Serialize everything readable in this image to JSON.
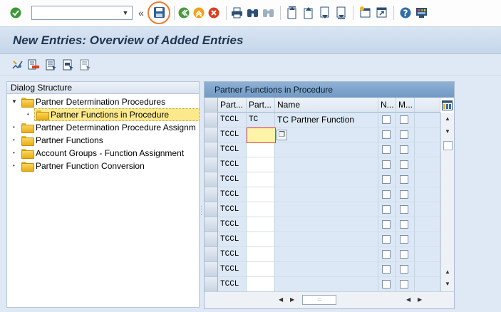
{
  "toolbar": {
    "command_field_value": "",
    "double_arrow": "«",
    "icons": [
      "enter-icon",
      "save-icon",
      "back-icon",
      "exit-icon",
      "cancel-icon",
      "print-icon",
      "find-icon",
      "find-next-icon",
      "first-page-icon",
      "previous-page-icon",
      "next-page-icon",
      "last-page-icon",
      "create-session-icon",
      "shortcut-icon",
      "help-icon",
      "layout-menu-icon"
    ]
  },
  "title": "New Entries: Overview of Added Entries",
  "dialog_structure": {
    "header": "Dialog Structure",
    "items": [
      {
        "label": "Partner Determination Procedures",
        "level": 0,
        "expanded": true
      },
      {
        "label": "Partner Functions in Procedure",
        "level": 1,
        "selected": true
      },
      {
        "label": "Partner Determination Procedure Assignm",
        "level": 0
      },
      {
        "label": "Partner Functions",
        "level": 0
      },
      {
        "label": "Account Groups - Function Assignment",
        "level": 0
      },
      {
        "label": "Partner Function Conversion",
        "level": 0
      }
    ]
  },
  "table": {
    "title": "Partner Functions in Procedure",
    "columns": [
      "Part...",
      "Part...",
      "Name",
      "N...",
      "M..."
    ],
    "rows": [
      {
        "proc": "TCCL",
        "func": "TC",
        "name": "TC Partner Function"
      },
      {
        "proc": "TCCL",
        "func": "",
        "name": ""
      },
      {
        "proc": "TCCL",
        "func": "",
        "name": ""
      },
      {
        "proc": "TCCL",
        "func": "",
        "name": ""
      },
      {
        "proc": "TCCL",
        "func": "",
        "name": ""
      },
      {
        "proc": "TCCL",
        "func": "",
        "name": ""
      },
      {
        "proc": "TCCL",
        "func": "",
        "name": ""
      },
      {
        "proc": "TCCL",
        "func": "",
        "name": ""
      },
      {
        "proc": "TCCL",
        "func": "",
        "name": ""
      },
      {
        "proc": "TCCL",
        "func": "",
        "name": ""
      },
      {
        "proc": "TCCL",
        "func": "",
        "name": ""
      },
      {
        "proc": "TCCL",
        "func": "",
        "name": ""
      }
    ]
  },
  "colors": {
    "save_highlight": "#f07a2a",
    "focus_border": "#e03b3b",
    "selection": "#fce98b"
  }
}
